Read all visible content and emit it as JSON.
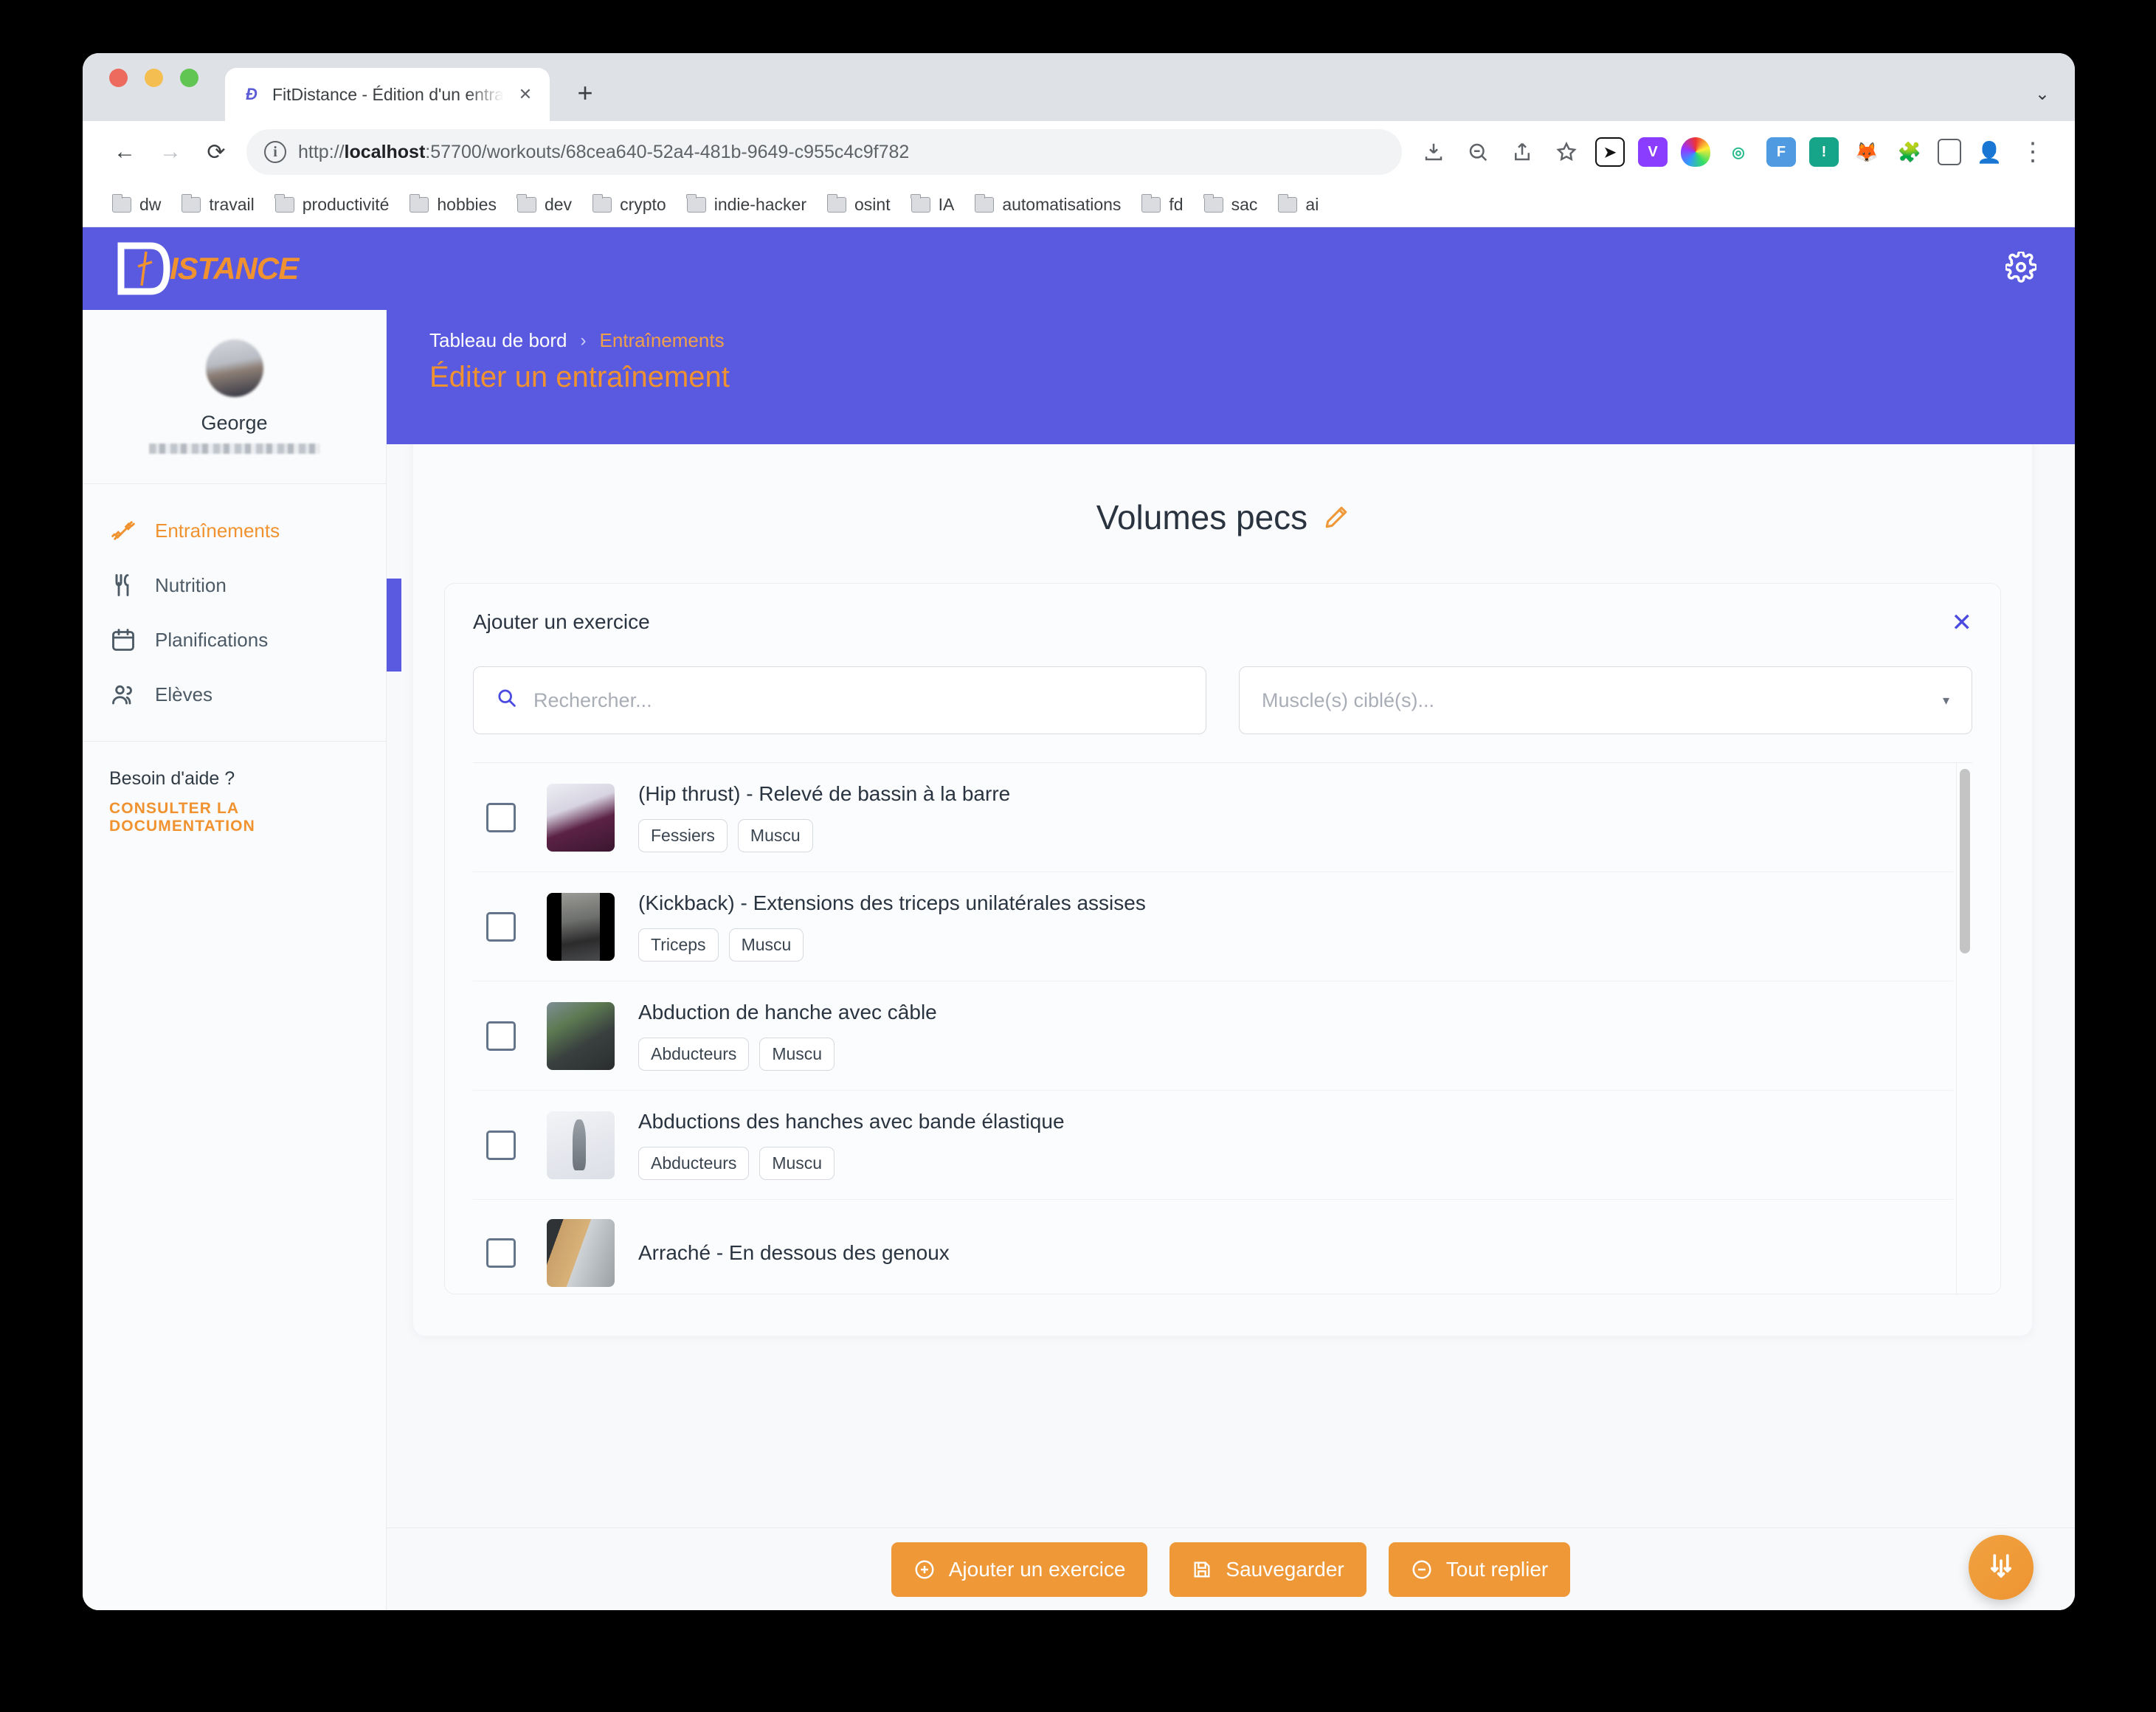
{
  "browser": {
    "tab": {
      "title": "FitDistance - Édition d'un entraî",
      "favicon": "fitdistance-logo",
      "close_label": "✕"
    },
    "new_tab_label": "+",
    "tabstrip_menu": "⌄",
    "nav": {
      "back": "←",
      "forward": "→",
      "reload": "⟳"
    },
    "url": {
      "scheme": "http://",
      "host": "localhost",
      "rest": ":57700/workouts/68cea640-52a4-481b-9649-c955c4c9f782"
    },
    "toolbar_icons": [
      "install-icon",
      "zoom-out-icon",
      "share-icon",
      "bookmark-star-icon"
    ],
    "extensions": [
      {
        "name": "cursor-extension",
        "glyph": "➤",
        "bg": "#ffffff",
        "fg": "#202124"
      },
      {
        "name": "vimium-extension",
        "glyph": "V",
        "bg": "#8b3dff",
        "fg": "#ffffff"
      },
      {
        "name": "colorpicker-extension",
        "glyph": "◉",
        "bg": "#ffffff",
        "fg": "#e04040"
      },
      {
        "name": "target-extension",
        "glyph": "◎",
        "bg": "#ffffff",
        "fg": "#25b98a"
      },
      {
        "name": "fitdistance-extension",
        "glyph": "F",
        "bg": "#4f9ae0",
        "fg": "#ffffff"
      },
      {
        "name": "lighthouse-extension",
        "glyph": "!",
        "bg": "#17a589",
        "fg": "#ffffff"
      },
      {
        "name": "metamask-extension",
        "glyph": "🦊",
        "bg": "#ffffff",
        "fg": "#e2761b"
      },
      {
        "name": "puzzle-extension",
        "glyph": "🧩",
        "bg": "#ffffff",
        "fg": "#5f6368"
      },
      {
        "name": "sidepanel-extension",
        "glyph": "▯",
        "bg": "#ffffff",
        "fg": "#5f6368"
      },
      {
        "name": "profile-avatar",
        "glyph": "👤",
        "bg": "#ffffff",
        "fg": "#5f6368"
      },
      {
        "name": "chrome-menu",
        "glyph": "⋮",
        "bg": "#ffffff",
        "fg": "#5f6368"
      }
    ],
    "bookmarks": [
      "dw",
      "travail",
      "productivité",
      "hobbies",
      "dev",
      "crypto",
      "indie-hacker",
      "osint",
      "IA",
      "automatisations",
      "fd",
      "sac",
      "ai"
    ]
  },
  "app": {
    "brand": {
      "mark": "FD",
      "text": "ISTANCE"
    },
    "settings_icon": "gear-icon",
    "sidebar": {
      "profile": {
        "name": "George",
        "email_redacted": true
      },
      "nav": [
        {
          "label": "Entraînements",
          "icon": "dumbbell-icon",
          "active": true
        },
        {
          "label": "Nutrition",
          "icon": "cutlery-icon",
          "active": false
        },
        {
          "label": "Planifications",
          "icon": "calendar-icon",
          "active": false
        },
        {
          "label": "Elèves",
          "icon": "users-icon",
          "active": false
        }
      ],
      "help": {
        "title": "Besoin d'aide ?",
        "link": "CONSULTER LA DOCUMENTATION"
      }
    },
    "hero": {
      "breadcrumb": {
        "root": "Tableau de bord",
        "separator": "›",
        "current": "Entraînements"
      },
      "page_title": "Éditer un entraînement"
    },
    "card": {
      "workout_title": "Volumes pecs",
      "edit_icon": "pencil-icon"
    },
    "add_panel": {
      "title": "Ajouter un exercice",
      "close_icon": "✕",
      "search": {
        "placeholder": "Rechercher...",
        "value": "",
        "icon": "search-icon"
      },
      "muscle_select": {
        "placeholder": "Muscle(s) ciblé(s)...",
        "caret": "▾"
      },
      "exercises": [
        {
          "name": "(Hip thrust) - Relevé de bassin à la barre",
          "tags": [
            "Fessiers",
            "Muscu"
          ],
          "thumb": "hip-thrust"
        },
        {
          "name": "(Kickback) - Extensions des triceps unilatérales assises",
          "tags": [
            "Triceps",
            "Muscu"
          ],
          "thumb": "kickback"
        },
        {
          "name": "Abduction de hanche avec câble",
          "tags": [
            "Abducteurs",
            "Muscu"
          ],
          "thumb": "cable-abduction"
        },
        {
          "name": "Abductions des hanches avec bande élastique",
          "tags": [
            "Abducteurs",
            "Muscu"
          ],
          "thumb": "band-abduction"
        },
        {
          "name": "Arraché - En dessous des genoux",
          "tags": [],
          "thumb": "snatch"
        }
      ]
    },
    "actions": [
      {
        "label": "Ajouter un exercice",
        "icon": "plus-circle-icon"
      },
      {
        "label": "Sauvegarder",
        "icon": "save-icon"
      },
      {
        "label": "Tout replier",
        "icon": "minus-circle-icon"
      }
    ],
    "fab": {
      "icon": "sliders-icon"
    }
  },
  "colors": {
    "brand_purple": "#5a5ae0",
    "accent_orange": "#ee9838",
    "text_dark": "#2a3440",
    "panel_bg": "#fafbfc"
  }
}
